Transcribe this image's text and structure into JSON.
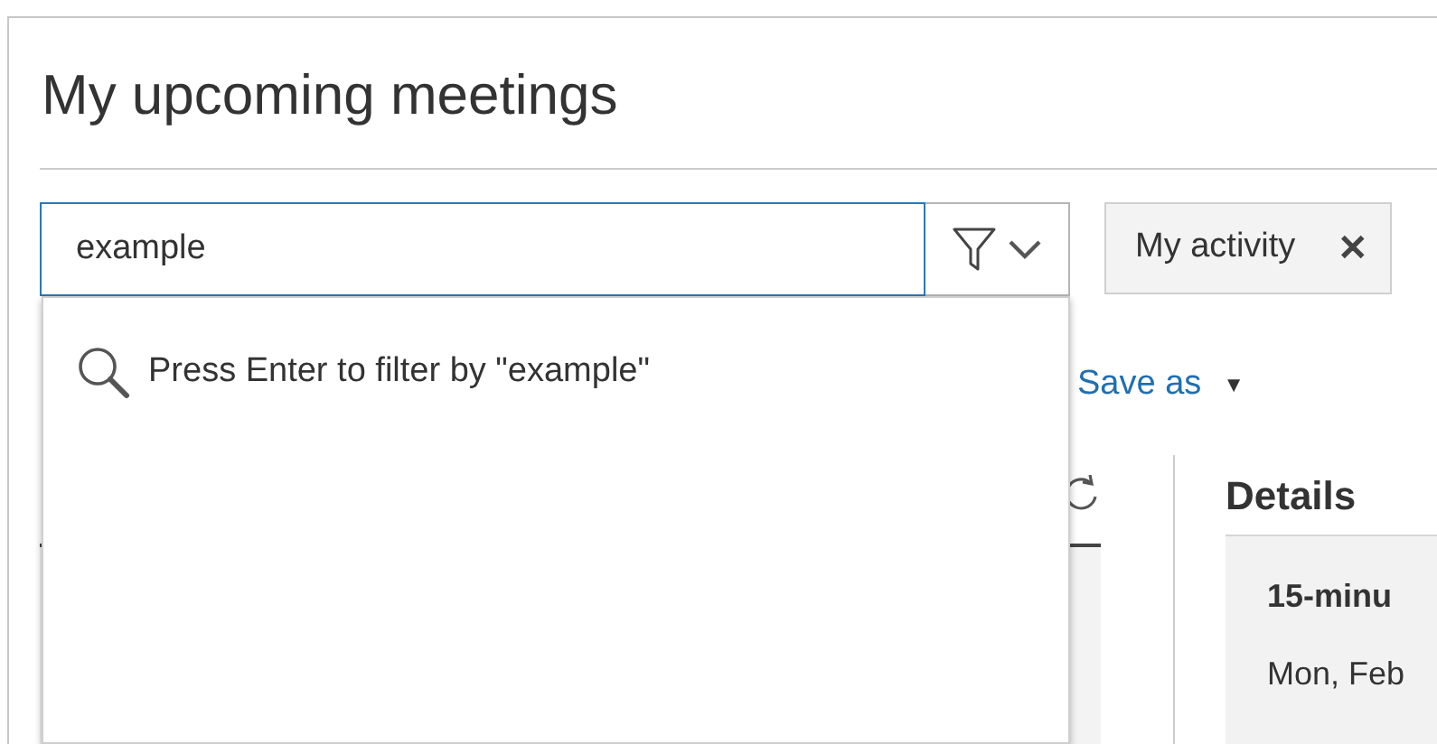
{
  "page": {
    "title": "My upcoming meetings"
  },
  "search": {
    "value": "example"
  },
  "filter_chip": {
    "label": "My activity",
    "remove": "✕"
  },
  "suggestion": {
    "text": "Press Enter to filter by \"example\""
  },
  "save_as": {
    "label": "Save as",
    "caret": "▼"
  },
  "details": {
    "heading": "Details",
    "card_title": "15-minu",
    "card_date": "Mon, Feb"
  }
}
